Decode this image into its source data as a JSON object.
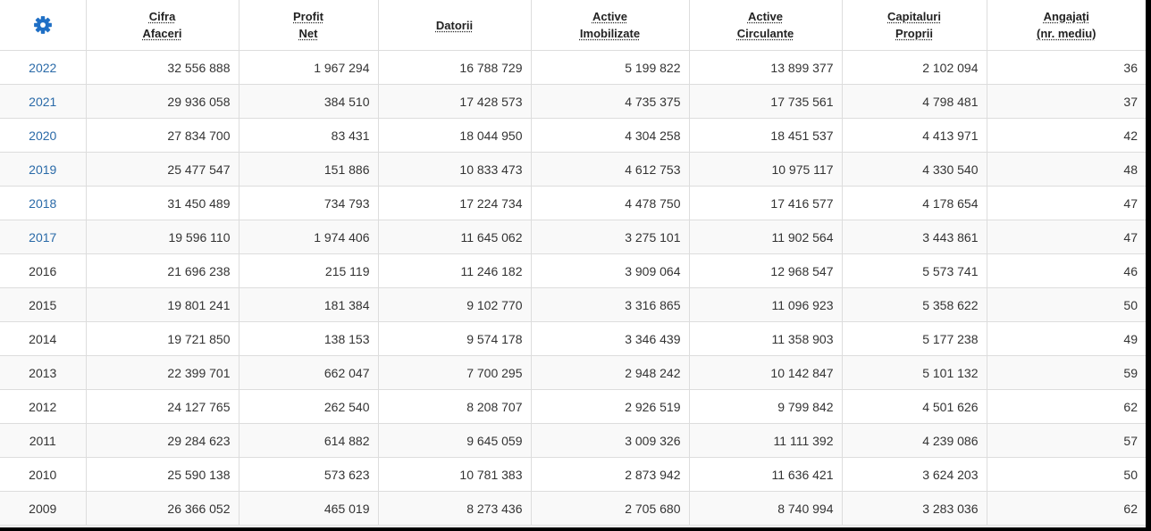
{
  "colors": {
    "accent": "#1f6fc5",
    "link": "#2a6aa8",
    "text": "#333333",
    "border": "#dddddd"
  },
  "settings_icon": "gear-icon",
  "headers": [
    {
      "key": "cifra_afaceri",
      "line1": "Cifra",
      "line2": "Afaceri"
    },
    {
      "key": "profit_net",
      "line1": "Profit",
      "line2": "Net"
    },
    {
      "key": "datorii",
      "line1": "Datorii",
      "line2": ""
    },
    {
      "key": "active_imobilizate",
      "line1": "Active",
      "line2": "Imobilizate"
    },
    {
      "key": "active_circulante",
      "line1": "Active",
      "line2": "Circulante"
    },
    {
      "key": "capitaluri_proprii",
      "line1": "Capitaluri",
      "line2": "Proprii"
    },
    {
      "key": "angajati",
      "line1": "Angajați",
      "line2": "(nr. mediu)"
    }
  ],
  "rows": [
    {
      "year": "2022",
      "link": true,
      "values": [
        "32 556 888",
        "1 967 294",
        "16 788 729",
        "5 199 822",
        "13 899 377",
        "2 102 094",
        "36"
      ]
    },
    {
      "year": "2021",
      "link": true,
      "values": [
        "29 936 058",
        "384 510",
        "17 428 573",
        "4 735 375",
        "17 735 561",
        "4 798 481",
        "37"
      ]
    },
    {
      "year": "2020",
      "link": true,
      "values": [
        "27 834 700",
        "83 431",
        "18 044 950",
        "4 304 258",
        "18 451 537",
        "4 413 971",
        "42"
      ]
    },
    {
      "year": "2019",
      "link": true,
      "values": [
        "25 477 547",
        "151 886",
        "10 833 473",
        "4 612 753",
        "10 975 117",
        "4 330 540",
        "48"
      ]
    },
    {
      "year": "2018",
      "link": true,
      "values": [
        "31 450 489",
        "734 793",
        "17 224 734",
        "4 478 750",
        "17 416 577",
        "4 178 654",
        "47"
      ]
    },
    {
      "year": "2017",
      "link": true,
      "values": [
        "19 596 110",
        "1 974 406",
        "11 645 062",
        "3 275 101",
        "11 902 564",
        "3 443 861",
        "47"
      ]
    },
    {
      "year": "2016",
      "link": false,
      "values": [
        "21 696 238",
        "215 119",
        "11 246 182",
        "3 909 064",
        "12 968 547",
        "5 573 741",
        "46"
      ]
    },
    {
      "year": "2015",
      "link": false,
      "values": [
        "19 801 241",
        "181 384",
        "9 102 770",
        "3 316 865",
        "11 096 923",
        "5 358 622",
        "50"
      ]
    },
    {
      "year": "2014",
      "link": false,
      "values": [
        "19 721 850",
        "138 153",
        "9 574 178",
        "3 346 439",
        "11 358 903",
        "5 177 238",
        "49"
      ]
    },
    {
      "year": "2013",
      "link": false,
      "values": [
        "22 399 701",
        "662 047",
        "7 700 295",
        "2 948 242",
        "10 142 847",
        "5 101 132",
        "59"
      ]
    },
    {
      "year": "2012",
      "link": false,
      "values": [
        "24 127 765",
        "262 540",
        "8 208 707",
        "2 926 519",
        "9 799 842",
        "4 501 626",
        "62"
      ]
    },
    {
      "year": "2011",
      "link": false,
      "values": [
        "29 284 623",
        "614 882",
        "9 645 059",
        "3 009 326",
        "11 111 392",
        "4 239 086",
        "57"
      ]
    },
    {
      "year": "2010",
      "link": false,
      "values": [
        "25 590 138",
        "573 623",
        "10 781 383",
        "2 873 942",
        "11 636 421",
        "3 624 203",
        "50"
      ]
    },
    {
      "year": "2009",
      "link": false,
      "values": [
        "26 366 052",
        "465 019",
        "8 273 436",
        "2 705 680",
        "8 740 994",
        "3 283 036",
        "62"
      ]
    }
  ]
}
